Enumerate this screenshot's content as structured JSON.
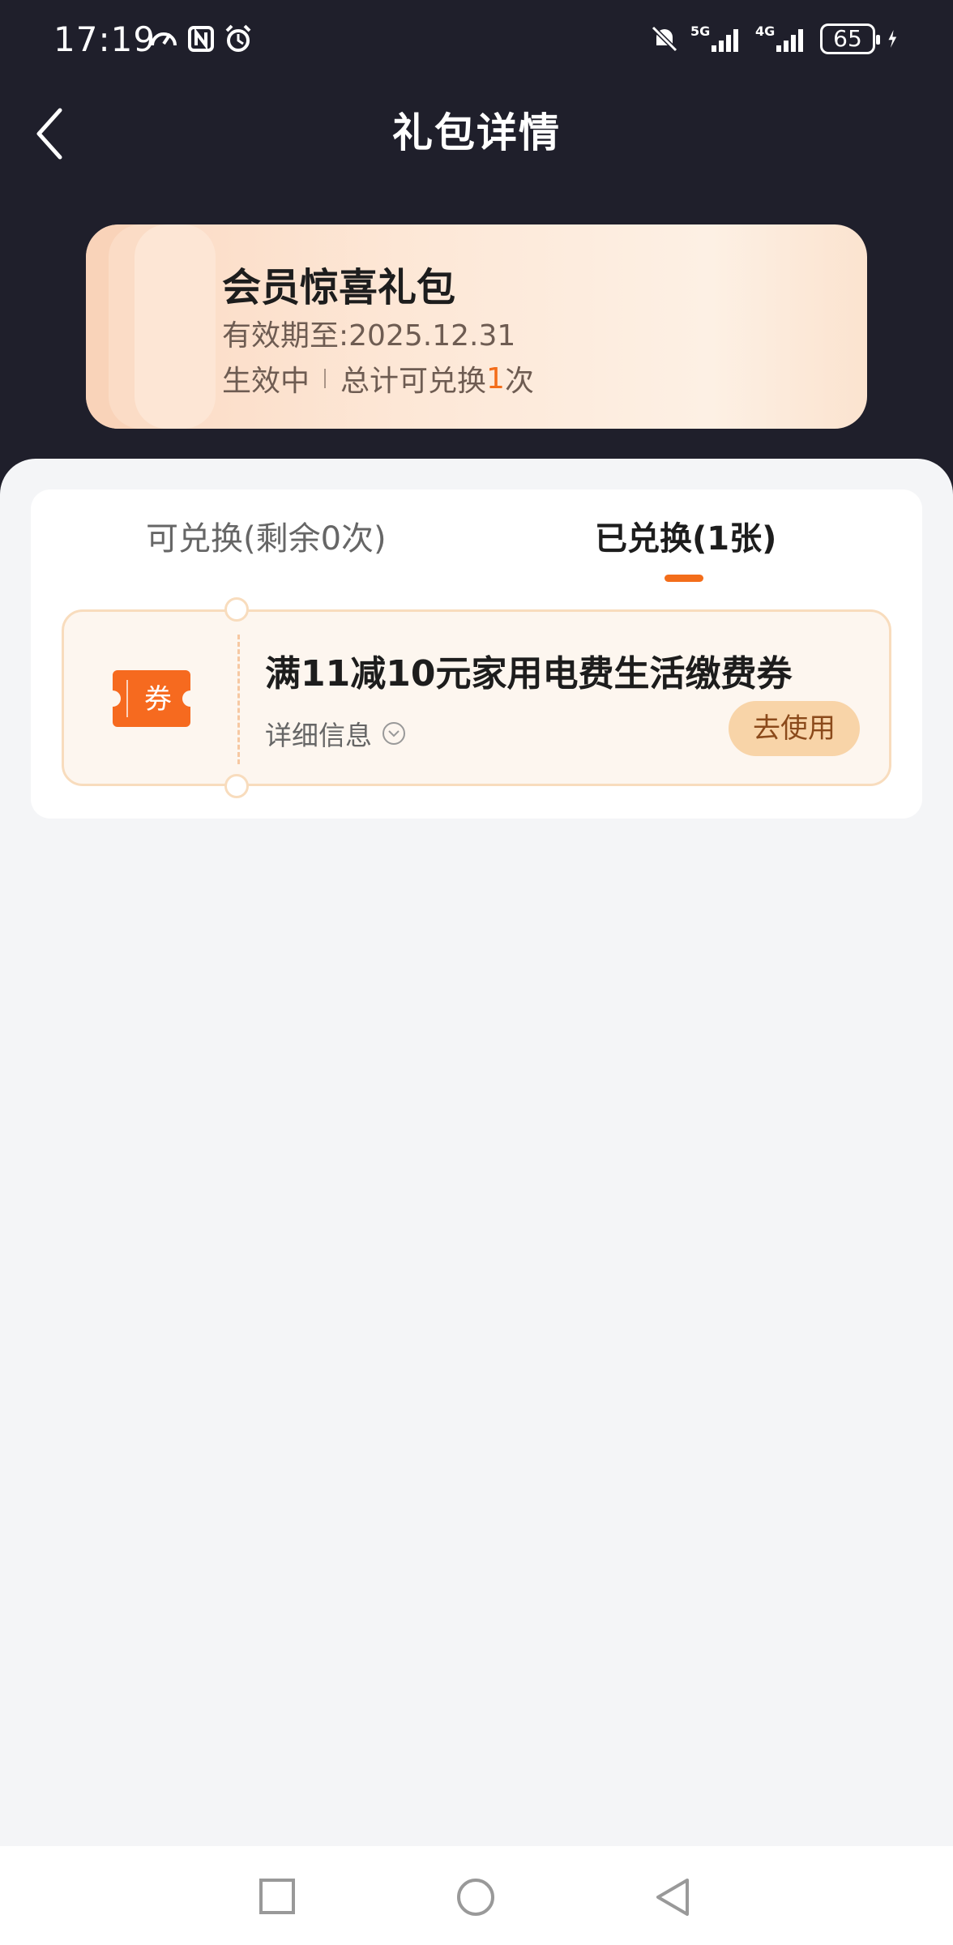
{
  "status_bar": {
    "time": "17:19",
    "battery": "65",
    "left_icons": [
      "speedometer-icon",
      "nfc-icon",
      "alarm-icon"
    ],
    "right_icons": [
      "mute-icon",
      "5g-signal-icon",
      "4g-signal-icon",
      "battery-icon",
      "charging-icon"
    ]
  },
  "nav": {
    "title": "礼包详情",
    "back_icon": "chevron-left-icon"
  },
  "gift": {
    "title": "会员惊喜礼包",
    "validity": "有效期至:2025.12.31",
    "status": "生效中",
    "total_prefix": "总计可兑换",
    "total_count": "1",
    "total_suffix": "次"
  },
  "tabs": {
    "available": "可兑换(剩余0次)",
    "redeemed": "已兑换(1张)",
    "active": "redeemed"
  },
  "coupon": {
    "badge": "券",
    "title": "满11减10元家用电费生活缴费券",
    "detail_label": "详细信息",
    "use_button": "去使用"
  },
  "colors": {
    "accent": "#f36d1a",
    "header_bg": "#1f1f2b",
    "page_bg": "#f4f5f7",
    "button_bg": "#f8d4a8"
  }
}
